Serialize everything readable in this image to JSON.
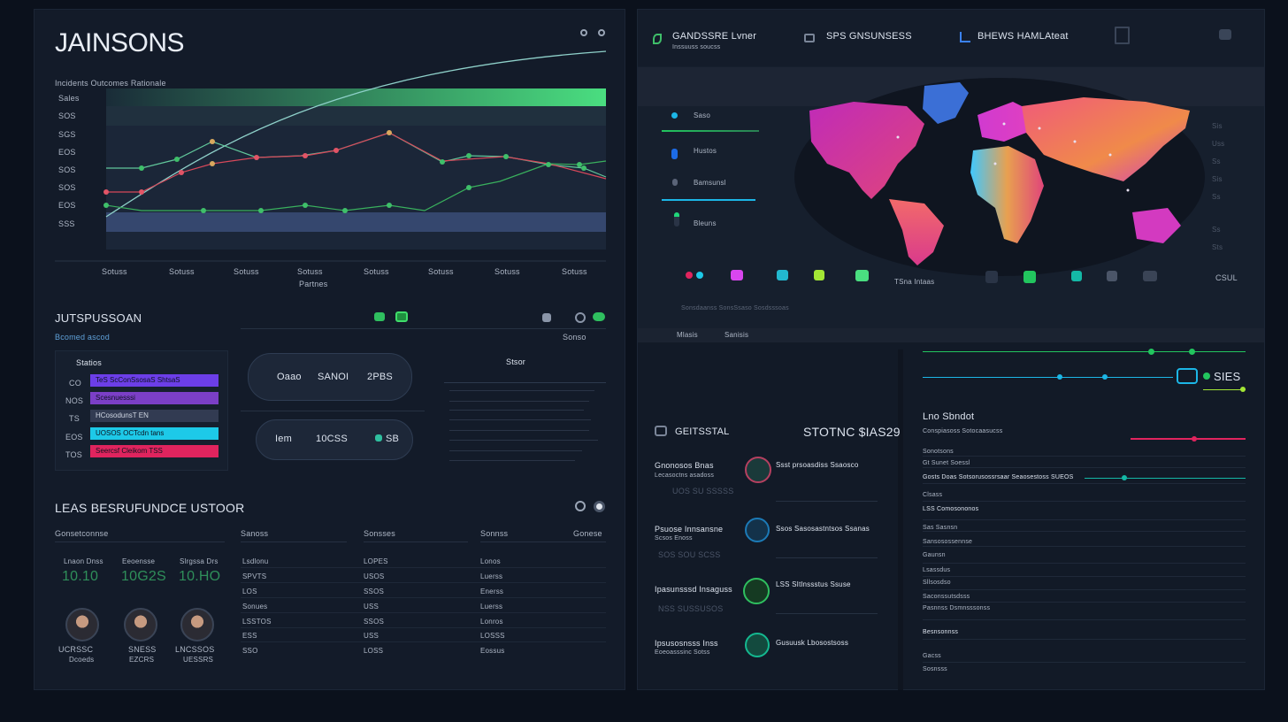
{
  "left": {
    "title": "JAINSONS",
    "chart": {
      "legend": "Incidents Outcomes Rationale",
      "y_ticks": [
        "Sales",
        "SOS",
        "SGS",
        "EOS",
        "SOS",
        "SOS",
        "EOS",
        "SSS"
      ],
      "x_ticks": [
        "Sotuss",
        "Sotuss",
        "Sotuss",
        "Sotuss",
        "Sotuss",
        "Sotuss",
        "Sotuss",
        "Sotuss"
      ],
      "x_label": "Partnes"
    },
    "section2": {
      "title": "JUTSPUSSOAN",
      "subtitle": "Bcomed ascod",
      "right_label": "Sonso",
      "box_title": "Statios",
      "rows": [
        {
          "num": "CO",
          "label": "TeS ScConSsosaS ShtsaS",
          "color": "#6c3ee8"
        },
        {
          "num": "NOS",
          "label": "Scesnuesssi",
          "color": "#7b3fc7"
        },
        {
          "num": "TS",
          "label": "HCosodunsT EN",
          "color": "#323b52"
        },
        {
          "num": "EOS",
          "label": "UOSOS OCTcdn tans",
          "color": "#1dc9e8"
        },
        {
          "num": "TOS",
          "label": "Seercsf Cleikom TSS",
          "color": "#e0245e"
        }
      ],
      "pill1": {
        "a": "Oaao",
        "b": "SANOI",
        "c": "2PBS"
      },
      "pill2": {
        "a": "Iem",
        "b": "10CSS",
        "c": "SB"
      },
      "list_title": "Stsor"
    },
    "section3": {
      "title": "LEAS BESRUFUNDCE USTOOR",
      "col_headers": [
        "Gonsetconnse",
        "Sanoss",
        "Sonsses",
        "Sonnss",
        "Gonese"
      ],
      "people": [
        {
          "name": "Lnaon Dnss",
          "value": "10.10",
          "caption": "UCRSSC",
          "sub": "Dcoeds"
        },
        {
          "name": "Eeoensse",
          "value": "10G2S",
          "caption": "SNESS",
          "sub": "EZCRS"
        },
        {
          "name": "Slrgssa Drs",
          "value": "10.HO",
          "caption": "LNCSSOS",
          "sub": "UESSRS"
        }
      ],
      "col1": [
        "Lsdlonu",
        "SPVTS",
        "LOS",
        "Sonues",
        "LSSTOS",
        "ESS",
        "SSO"
      ],
      "col2": [
        "LOPES",
        "USOS",
        "SSOS",
        "USS",
        "SSOS",
        "USS",
        "LOSS"
      ],
      "col3": [
        "Lonos",
        "Luerss",
        "Enerss",
        "Luerss",
        "Lonros",
        "LOSSS",
        "Eossus"
      ]
    }
  },
  "right": {
    "header_items": [
      {
        "title": "GANDSSRE Lvner",
        "sub": "Inssuuss soucss"
      },
      {
        "title": "SPS GNSUNSESS",
        "sub": ""
      },
      {
        "title": "BHEWS HAMLAteat",
        "sub": ""
      }
    ],
    "map_legend": [
      {
        "label": "Saso",
        "color": "#1cb6e6"
      },
      {
        "label": "Hustos",
        "color": "#1c6be6"
      },
      {
        "label": "Bamsunsl",
        "color": "#1cb6e6"
      },
      {
        "label": "Bleuns",
        "color": "#20d67a"
      }
    ],
    "map_right_labels": [
      "Sis",
      "Uss",
      "Ss",
      "Sis",
      "Ss",
      "Ss",
      "Sts"
    ],
    "map_footer": "Sonsdaanss SonsSsaso Sosdsssoas",
    "map_footer_label": "TSna Intaas",
    "map_corner": "CSUL",
    "tabs": [
      "Mlasis",
      "Sanisis"
    ],
    "mid": {
      "label": "GEITSSTAL",
      "value": "STOTNC $IAS29",
      "rows": [
        {
          "title": "Gnonosos Bnas",
          "sub": "Lecasoctns asadoss",
          "extra": "UOS SU SSSSS",
          "right": "Ssst prsoasdiss Ssaosco"
        },
        {
          "title": "Psuose Innsansne",
          "sub": "Scsos Enoss",
          "extra": "SOS SOU SCSS",
          "right": "Ssos Sasosastntsos Ssanas"
        },
        {
          "title": "Ipasunsssd Insaguss",
          "sub": "",
          "extra": "NSS SUSSUSOS",
          "right": "LSS SItlnssstus Ssuse"
        },
        {
          "title": "Ipsusosnsss Inss",
          "sub": "Eoeoasssinc Sotss",
          "extra": "",
          "right": "Gusuusk Lbosostsoss"
        }
      ]
    },
    "list": {
      "badge": "SIES",
      "title": "Lno Sbndot",
      "sub": "Conspiasoss Sotocaasucss",
      "items": [
        "Sonotsons",
        "Gt Sunet Soessl",
        "Gosts Doas Sotsorusossrsaar Seaosestoss SUEOS",
        "Clsass",
        "LSS Comosononos",
        "Sas Sasnsn",
        "Sansosossennse",
        "Gaunsn",
        "Lsassdus",
        "Sllsosdso",
        "Saconssutsdsss",
        "Pasnnss Dsmnsssonss",
        "Besnsonnss",
        "Gacss",
        "Sosnsss"
      ]
    }
  }
}
